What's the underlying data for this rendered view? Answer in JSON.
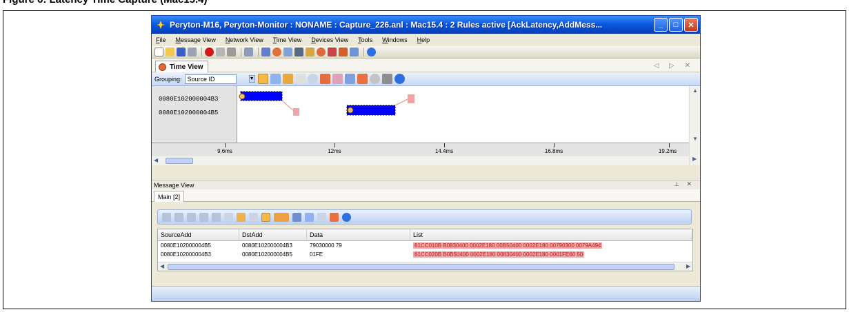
{
  "caption_fragment": "Figure 6: Latency Time Capture (Mac15.4)",
  "window": {
    "title": "Peryton-M16, Peryton-Monitor : NONAME : Capture_226.anl :  Mac15.4 : 2 Rules active [AckLatency,AddMess...",
    "minimize": "_",
    "maximize": "□",
    "close": "✕"
  },
  "menu": [
    "File",
    "Message View",
    "Network View",
    "Time View",
    "Devices View",
    "Tools",
    "Windows",
    "Help"
  ],
  "time_view": {
    "tab_label": "Time View",
    "nav": "◁ ▷ ✕",
    "grouping_label": "Grouping:",
    "grouping_value": "Source ID",
    "sources": [
      "0080E102000004B3",
      "0080E102000004B5"
    ],
    "ticks": [
      "9.6ms",
      "12ms",
      "14.4ms",
      "16.8ms",
      "19.2ms"
    ]
  },
  "message_view": {
    "title": "Message View",
    "pin": "⊥ ✕",
    "tab_label": "Main [2]",
    "columns": [
      "SourceAdd",
      "DstAdd",
      "Data",
      "List"
    ],
    "rows": [
      {
        "source": "0080E102000004B5",
        "dst": "0080E102000004B3",
        "data": "79030000 79",
        "list": "61CC010B B0830400 0002E180 00B50400 0002E180 00790300 0079A494"
      },
      {
        "source": "0080E102000004B3",
        "dst": "0080E102000004B5",
        "data": "01FE",
        "list": "61CC020B B0B50400 0002E180 00830400 0002E180 0001FE60 50"
      }
    ]
  },
  "colors": {
    "title_bar": "#0a5ae0",
    "bar_blue": "#0000ff",
    "highlight_red": "#f4a3a3"
  }
}
